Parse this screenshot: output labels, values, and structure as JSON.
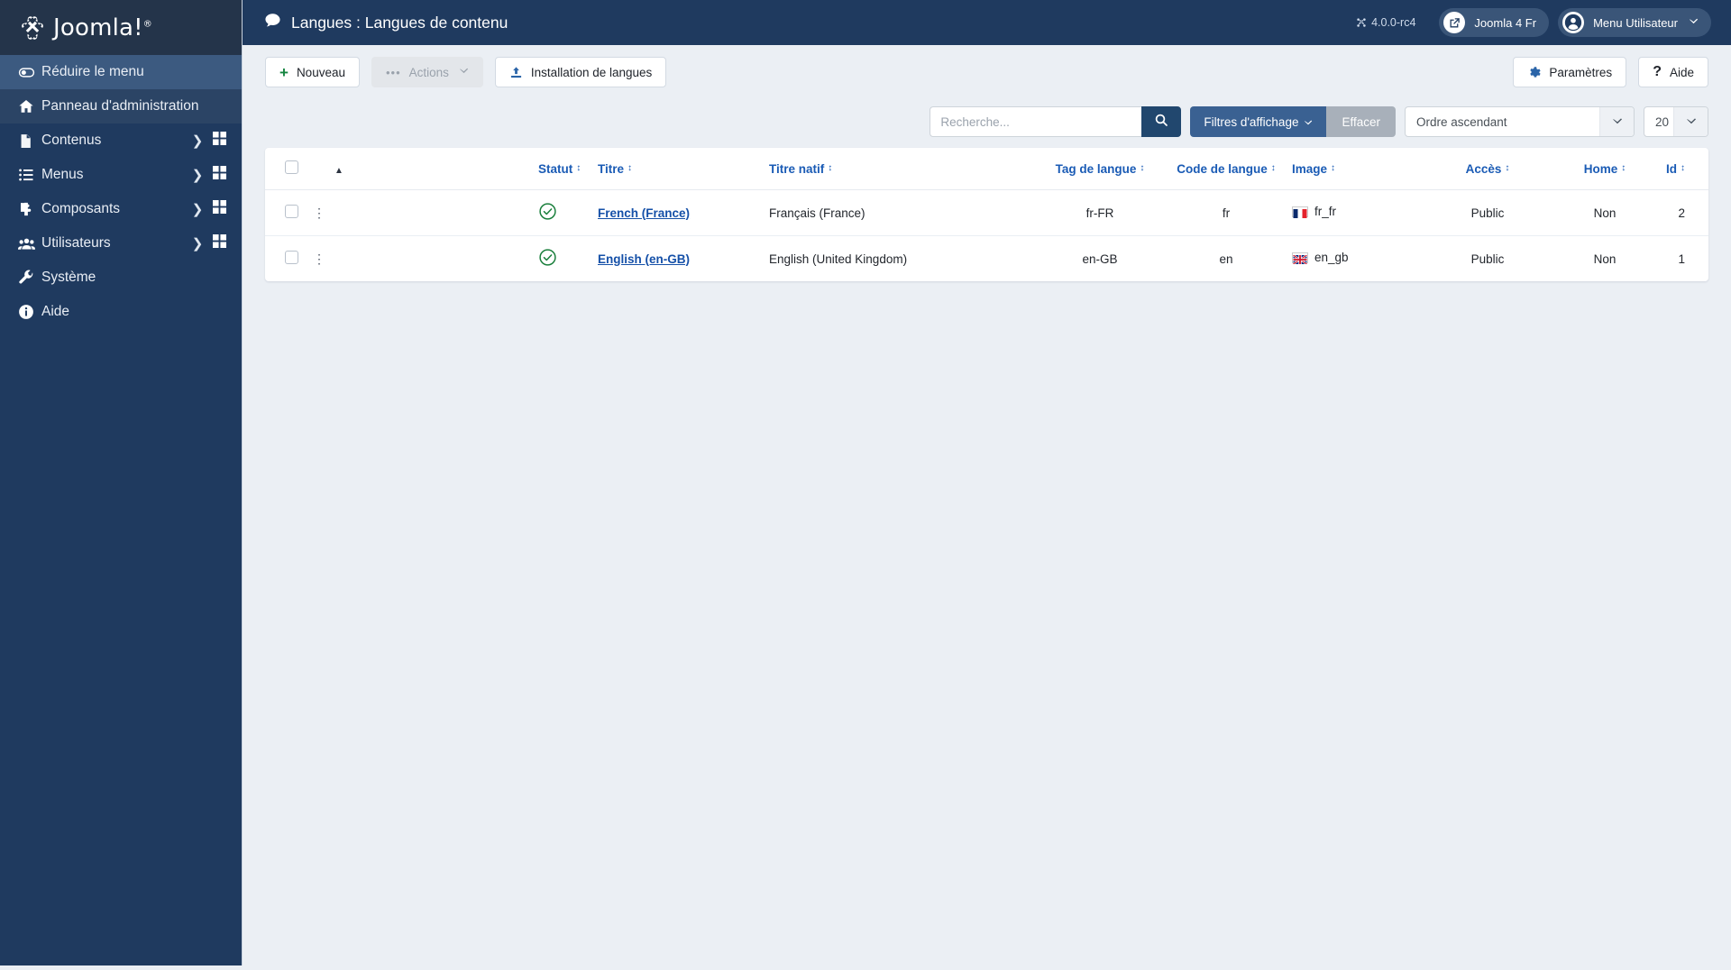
{
  "brand": {
    "name": "Joomla!",
    "reg": "®",
    "icon": "joomla-logo-icon"
  },
  "sidebar": {
    "items": [
      {
        "label": "Réduire le menu",
        "icon": "collapse-toggle-icon",
        "state": "active",
        "has_caret": false,
        "has_grid": false
      },
      {
        "label": "Panneau d'administration",
        "icon": "home-icon",
        "state": "current",
        "has_caret": false,
        "has_grid": false
      },
      {
        "label": "Contenus",
        "icon": "document-icon",
        "state": "normal",
        "has_caret": true,
        "has_grid": true
      },
      {
        "label": "Menus",
        "icon": "list-icon",
        "state": "normal",
        "has_caret": true,
        "has_grid": true
      },
      {
        "label": "Composants",
        "icon": "puzzle-icon",
        "state": "normal",
        "has_caret": true,
        "has_grid": true
      },
      {
        "label": "Utilisateurs",
        "icon": "users-icon",
        "state": "normal",
        "has_caret": true,
        "has_grid": true
      },
      {
        "label": "Système",
        "icon": "wrench-icon",
        "state": "normal",
        "has_caret": false,
        "has_grid": false
      },
      {
        "label": "Aide",
        "icon": "info-icon",
        "state": "normal",
        "has_caret": false,
        "has_grid": false
      }
    ],
    "caret_glyph": "❯",
    "grid_glyph": "grid-icon"
  },
  "header": {
    "title": "Langues : Langues de contenu",
    "title_icon": "comment-icon",
    "version": "4.0.0-rc4",
    "version_icon": "joomla-mark-icon",
    "site_button": {
      "label": "Joomla 4 Fr",
      "icon": "external-link-icon"
    },
    "user_menu": {
      "label": "Menu Utilisateur",
      "icon": "user-circle-icon",
      "chevron": "⌄"
    }
  },
  "toolbar": {
    "new_label": "Nouveau",
    "new_icon": "plus-icon",
    "actions_label": "Actions",
    "actions_icon": "ellipsis-icon",
    "actions_chevron": "⌄",
    "install_label": "Installation de langues",
    "install_icon": "upload-icon",
    "options_label": "Paramètres",
    "options_icon": "gear-icon",
    "help_label": "Aide",
    "help_icon": "question-mark-icon"
  },
  "filters": {
    "search_placeholder": "Recherche...",
    "search_value": "",
    "search_icon": "search-icon",
    "filters_label": "Filtres d'affichage",
    "filters_chevron": "⌄",
    "clear_label": "Effacer",
    "order_value": "Ordre ascendant",
    "order_chevron": "⌄",
    "limit_value": "20",
    "limit_chevron": "⌄"
  },
  "table": {
    "columns": [
      {
        "key": "check",
        "label": "",
        "icon": "select-all-checkbox",
        "sortable": false
      },
      {
        "key": "kebab",
        "label": "",
        "icon": "",
        "sortable": false
      },
      {
        "key": "ordering",
        "label": "",
        "icon": "sort-asc-icon",
        "sortable": true
      },
      {
        "key": "status",
        "label": "Statut",
        "sortable": true
      },
      {
        "key": "title",
        "label": "Titre",
        "sortable": true
      },
      {
        "key": "native",
        "label": "Titre natif",
        "sortable": true
      },
      {
        "key": "tag",
        "label": "Tag de langue",
        "sortable": true
      },
      {
        "key": "code",
        "label": "Code de langue",
        "sortable": true
      },
      {
        "key": "image",
        "label": "Image",
        "sortable": true
      },
      {
        "key": "access",
        "label": "Accès",
        "sortable": true
      },
      {
        "key": "home",
        "label": "Home",
        "sortable": true
      },
      {
        "key": "id",
        "label": "Id",
        "sortable": true
      }
    ],
    "sort_glyph": "↕",
    "asc_glyph": "▲",
    "kebab_glyph": "⋮",
    "rows": [
      {
        "status": "published",
        "status_icon": "check-circle-icon",
        "title": "French (France)",
        "native": "Français (France)",
        "tag": "fr-FR",
        "code": "fr",
        "image": "fr_fr",
        "image_flag": "flag-france",
        "access": "Public",
        "home": "Non",
        "id": "2"
      },
      {
        "status": "published",
        "status_icon": "check-circle-icon",
        "title": "English (en-GB)",
        "native": "English (United Kingdom)",
        "tag": "en-GB",
        "code": "en",
        "image": "en_gb",
        "image_flag": "flag-uk",
        "access": "Public",
        "home": "Non",
        "id": "1"
      }
    ]
  },
  "colors": {
    "sidebar_bg": "#1f3a5f",
    "header_bg": "#1f3a5f",
    "page_bg": "#ebeff4",
    "link_blue": "#1a5bb5",
    "filter_blue": "#3a6192",
    "search_blue": "#21476e",
    "clear_grey": "#a8b0ba",
    "published_green": "#1a7f3c",
    "accent_blue": "#2a64a8"
  }
}
